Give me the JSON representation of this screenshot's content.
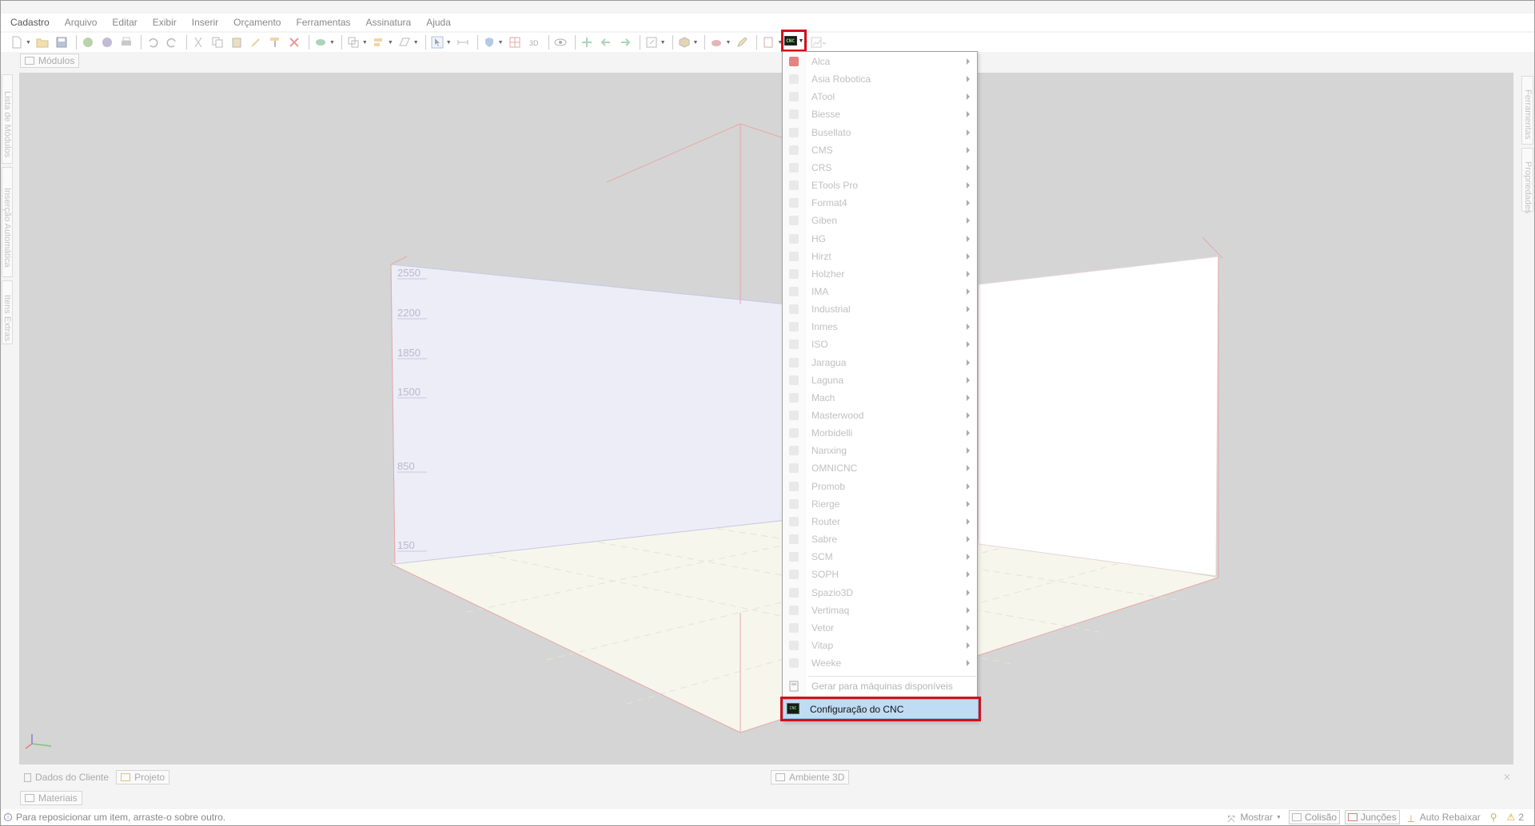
{
  "menubar": {
    "items": [
      "Cadastro",
      "Arquivo",
      "Editar",
      "Exibir",
      "Inserir",
      "Orçamento",
      "Ferramentas",
      "Assinatura",
      "Ajuda"
    ]
  },
  "toolbar": {
    "cnc_button_glyph": "CNC"
  },
  "tabs_top": {
    "modulos": "Módulos"
  },
  "left_panel": {
    "tabs": [
      "Lista de Módulos",
      "Inserção Automática",
      "Itens Extras"
    ]
  },
  "right_panel": {
    "tabs": [
      "Ferramentas",
      "Propriedades"
    ]
  },
  "viewport": {
    "dimension_labels": [
      "2550",
      "2200",
      "1850",
      "1500",
      "850",
      "150"
    ]
  },
  "cnc_menu": {
    "items": [
      {
        "label": "Alca",
        "icon": "alca-icon"
      },
      {
        "label": "Asia Robotica",
        "icon": "asia-robotica-icon"
      },
      {
        "label": "ATool",
        "icon": "atool-icon"
      },
      {
        "label": "Biesse",
        "icon": "biesse-icon"
      },
      {
        "label": "Busellato",
        "icon": "busellato-icon"
      },
      {
        "label": "CMS",
        "icon": "cms-icon"
      },
      {
        "label": "CRS",
        "icon": "crs-icon"
      },
      {
        "label": "ETools Pro",
        "icon": "etools-pro-icon"
      },
      {
        "label": "Format4",
        "icon": "format4-icon"
      },
      {
        "label": "Giben",
        "icon": "giben-icon"
      },
      {
        "label": "HG",
        "icon": "hg-icon"
      },
      {
        "label": "Hirzt",
        "icon": "hirzt-icon"
      },
      {
        "label": "Holzher",
        "icon": "holzher-icon"
      },
      {
        "label": "IMA",
        "icon": "ima-icon"
      },
      {
        "label": "Industrial",
        "icon": "industrial-icon"
      },
      {
        "label": "Inmes",
        "icon": "inmes-icon"
      },
      {
        "label": "ISO",
        "icon": "iso-icon"
      },
      {
        "label": "Jaragua",
        "icon": "jaragua-icon"
      },
      {
        "label": "Laguna",
        "icon": "laguna-icon"
      },
      {
        "label": "Mach",
        "icon": "mach-icon"
      },
      {
        "label": "Masterwood",
        "icon": "masterwood-icon"
      },
      {
        "label": "Morbidelli",
        "icon": "morbidelli-icon"
      },
      {
        "label": "Nanxing",
        "icon": "nanxing-icon"
      },
      {
        "label": "OMNICNC",
        "icon": "omnicnc-icon"
      },
      {
        "label": "Promob",
        "icon": "promob-icon"
      },
      {
        "label": "Rierge",
        "icon": "rierge-icon"
      },
      {
        "label": "Router",
        "icon": "router-icon"
      },
      {
        "label": "Sabre",
        "icon": "sabre-icon"
      },
      {
        "label": "SCM",
        "icon": "scm-icon"
      },
      {
        "label": "SOPH",
        "icon": "soph-icon"
      },
      {
        "label": "Spazio3D",
        "icon": "spazio3d-icon"
      },
      {
        "label": "Vertimaq",
        "icon": "vertimaq-icon"
      },
      {
        "label": "Vetor",
        "icon": "vetor-icon"
      },
      {
        "label": "Vitap",
        "icon": "vitap-icon"
      },
      {
        "label": "Weeke",
        "icon": "weeke-icon"
      }
    ],
    "generate_label": "Gerar para máquinas disponíveis",
    "config_label": "Configuração do CNC",
    "config_icon_glyph": "CNC"
  },
  "bottom_tabs": {
    "dados_cliente": "Dados do Cliente",
    "projeto": "Projeto",
    "ambiente_3d": "Ambiente 3D",
    "materiais": "Materiais"
  },
  "status": {
    "message": "Para reposicionar um item, arraste-o sobre outro.",
    "mostrar": "Mostrar",
    "colisao": "Colisão",
    "juncoes": "Junções",
    "auto_rebaixar": "Auto Rebaixar",
    "warnings_count": "2"
  },
  "colors": {
    "highlight_border": "#d0101a",
    "selected_item_bg": "#bfdcf5",
    "viewport_bg": "#d5d5d5"
  }
}
